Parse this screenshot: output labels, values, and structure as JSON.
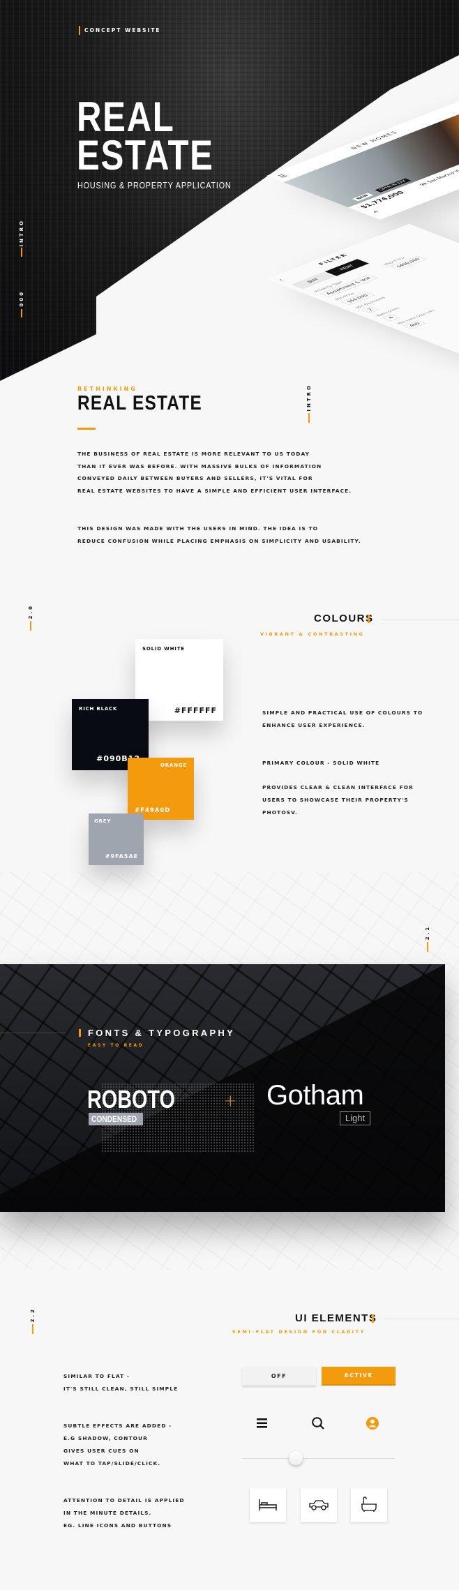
{
  "colors": {
    "accent": "#F49A0D",
    "rich_black": "#090B12",
    "white": "#FFFFFF",
    "grey": "#9FA5AE"
  },
  "hero": {
    "tag": "CONCEPT WEBSITE",
    "title_line1": "REAL",
    "title_line2": "ESTATE",
    "subtitle": "HOUSING & PROPERTY APPLICATION",
    "side_label": "INTRO",
    "side_number": "000"
  },
  "mockup": {
    "listing": {
      "title": "NEW HOMES",
      "badge": "NEW",
      "open_label": "OPEN IN JULY",
      "price": "$1,774,000",
      "address": "9A San Marino Vis Sa",
      "beds": "4"
    },
    "filter": {
      "title": "FILTER",
      "tab_buy": "BUY",
      "tab_rent": "RENT",
      "fields": [
        {
          "label": "Property Type",
          "value": "Appartment & Unit"
        },
        {
          "label": "Min Price",
          "value": "$50,000"
        },
        {
          "label": "Max Price",
          "value": "$400,000"
        },
        {
          "label": "Min Bedrooms",
          "value": "2"
        },
        {
          "label": "Bathrooms",
          "value": "4"
        },
        {
          "label": "Min Land Size (m²)",
          "value": "400"
        }
      ]
    }
  },
  "intro": {
    "eyebrow": "RETHINKING",
    "title": "REAL ESTATE",
    "side_label": "INTRO",
    "paragraph1": [
      "THE BUSINESS OF REAL ESTATE  IS MORE RELEVANT TO US TODAY",
      "THAN IT EVER WAS BEFORE. WITH MASSIVE BULKS OF INFORMATION",
      "CONVEYED DAILY BETWEEN BUYERS AND SELLERS, IT'S VITAL FOR",
      "REAL ESTATE WEBSITES TO HAVE A SIMPLE AND EFFICIENT USER INTERFACE."
    ],
    "paragraph2": [
      "THIS DESIGN WAS MADE WITH THE USERS IN MIND. THE IDEA IS TO",
      "REDUCE CONFUSION WHILE PLACING EMPHASIS ON SIMPLICITY AND USABILITY."
    ]
  },
  "colours": {
    "section_number": "2.0",
    "title": "COLOURS",
    "subtitle": "VIBRANT & CONTRASTING",
    "swatches": [
      {
        "name": "SOLID WHITE",
        "hex": "#FFFFFF"
      },
      {
        "name": "RICH BLACK",
        "hex": "#090B12"
      },
      {
        "name": "ORANGE",
        "hex": "#F49A0D"
      },
      {
        "name": "GREY",
        "hex": "#9FA5AE"
      }
    ],
    "text1": [
      "SIMPLE AND PRACTICAL USE OF COLOURS TO",
      "ENHANCE USER EXPERIENCE."
    ],
    "text2": "PRIMARY COLOUR - SOLID WHITE",
    "text3": [
      "PROVIDES CLEAR & CLEAN INTERFACE FOR",
      "USERS TO SHOWCASE THEIR PROPERTY'S",
      "PHOTOSV."
    ]
  },
  "fonts": {
    "section_number": "2.1",
    "title": "FONTS & TYPOGRAPHY",
    "subtitle": "EASY TO READ",
    "font1": "ROBOTO",
    "font1_style": "CONDENSED",
    "plus": "+",
    "font2": "Gotham",
    "font2_style": "Light"
  },
  "ui": {
    "section_number": "2.2",
    "title": "UI ELEMENTS",
    "subtitle": "SEMI-FLAT DESIGN FOR CLARITY",
    "text1": [
      "SIMILAR TO FLAT -",
      "IT'S STILL CLEAN, STILL SIMPLE"
    ],
    "text2": [
      "SUBTLE EFFECTS ARE ADDED -",
      "E.G SHADOW, CONTOUR",
      "GIVES USER CUES ON",
      "WHAT TO TAP/SLIDE/CLICK."
    ],
    "text3": [
      "ATTENTION TO DETAIL IS APPLIED",
      "IN THE MINUTE DETAILS.",
      "EG. LINE ICONS AND BUTTONS"
    ],
    "off_label": "OFF",
    "active_label": "ACTIVE",
    "icons": [
      "menu-icon",
      "search-icon",
      "user-icon",
      "bed-icon",
      "car-icon",
      "bath-icon"
    ],
    "slider_value_percent": 35
  }
}
